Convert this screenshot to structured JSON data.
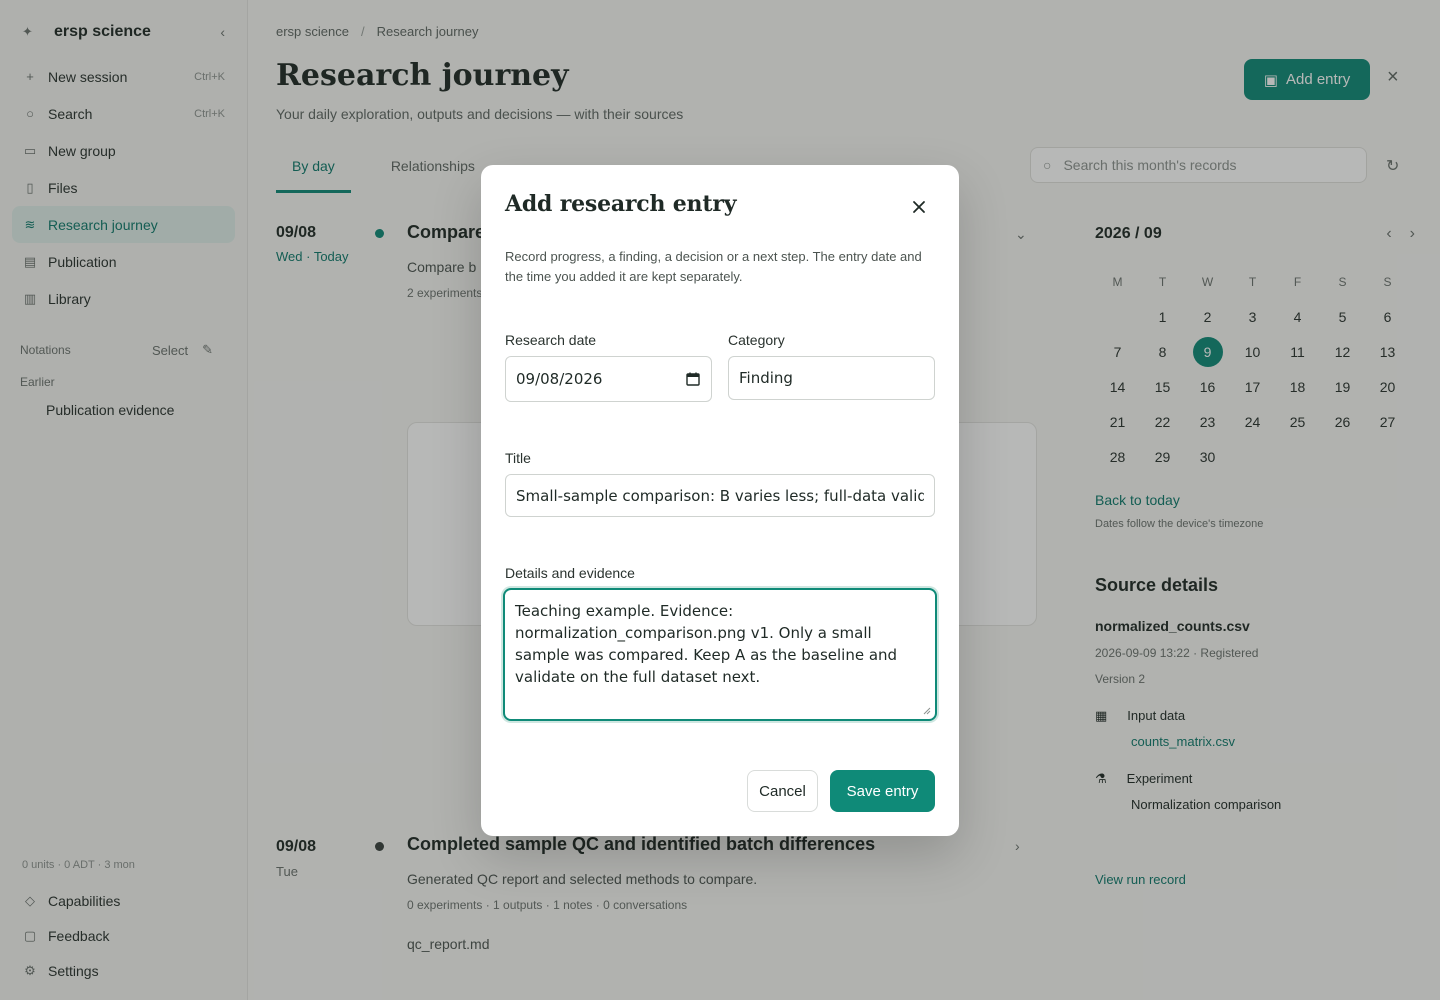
{
  "app": {
    "brand": "ersp science",
    "collapse_icon": "sidebar-collapse-icon"
  },
  "sidebar": {
    "items": [
      {
        "label": "New session",
        "shortcut": "Ctrl+K",
        "icon": "plus-icon"
      },
      {
        "label": "Search",
        "shortcut": "Ctrl+K",
        "icon": "search-icon"
      },
      {
        "label": "New group",
        "shortcut": "",
        "icon": "folder-plus-icon"
      },
      {
        "label": "Files",
        "shortcut": "",
        "icon": "file-icon"
      },
      {
        "label": "Research journey",
        "shortcut": "",
        "icon": "journey-icon"
      },
      {
        "label": "Publication",
        "shortcut": "",
        "icon": "document-icon"
      },
      {
        "label": "Library",
        "shortcut": "",
        "icon": "library-icon"
      }
    ],
    "section_label": "Notations",
    "section_action": "Select",
    "sub_label": "Earlier",
    "leaf": "Publication evidence",
    "status": "0 units · 0 ADT · 3 mon",
    "bottom_items": [
      {
        "label": "Capabilities",
        "icon": "capabilities-icon"
      },
      {
        "label": "Feedback",
        "icon": "feedback-icon"
      },
      {
        "label": "Settings",
        "icon": "gear-icon"
      }
    ]
  },
  "header": {
    "breadcrumb_root": "ersp science",
    "breadcrumb_current": "Research journey",
    "title": "Research journey",
    "subtitle": "Your daily exploration, outputs and decisions — with their sources",
    "add_button": "Add entry"
  },
  "tabs": [
    "By day",
    "Relationships"
  ],
  "search": {
    "placeholder": "Search this month's records"
  },
  "timeline": [
    {
      "date": "09/08",
      "sub": "Wed · Today",
      "title": "Compare",
      "text": "Compare b",
      "meta": "2 experiments"
    },
    {
      "date": "09/08",
      "sub": "Tue",
      "title": "Completed sample QC and identified batch differences",
      "text": "Generated QC report and selected methods to compare.",
      "meta": "0 experiments · 1 outputs · 1 notes · 0 conversations",
      "file": "qc_report.md"
    }
  ],
  "calendar": {
    "title": "2026 / 09",
    "weekdays": [
      "M",
      "T",
      "W",
      "T",
      "F",
      "S",
      "S"
    ],
    "days": [
      "",
      "1",
      "2",
      "3",
      "4",
      "5",
      "6",
      "7",
      "8",
      "9",
      "10",
      "11",
      "12",
      "13",
      "14",
      "15",
      "16",
      "17",
      "18",
      "19",
      "20",
      "21",
      "22",
      "23",
      "24",
      "25",
      "26",
      "27",
      "28",
      "29",
      "30"
    ],
    "selected_day": "9",
    "back_link": "Back to today",
    "note": "Dates follow the device's timezone"
  },
  "source": {
    "title": "Source details",
    "file": "normalized_counts.csv",
    "meta": "2026-09-09 13:22 · Registered",
    "version": "Version 2",
    "input_label": "Input data",
    "input_link": "counts_matrix.csv",
    "experiment_label": "Experiment",
    "experiment_name": "Normalization comparison",
    "view_link": "View run record"
  },
  "modal": {
    "title": "Add research entry",
    "description": "Record progress, a finding, a decision or a next step. The entry date and the time you added it are kept separately.",
    "date_label": "Research date",
    "date_value": "09/08/2026",
    "category_label": "Category",
    "category_value": "Finding",
    "title_label": "Title",
    "title_value": "Small-sample comparison: B varies less; full-data validation",
    "details_label": "Details and evidence",
    "details_value": "Teaching example. Evidence: normalization_comparison.png v1. Only a small sample was compared. Keep A as the baseline and validate on the full dataset next.",
    "cancel": "Cancel",
    "save": "Save entry"
  },
  "colors": {
    "accent": "#0f8a78",
    "overlay": "rgba(30,34,32,0.32)"
  }
}
